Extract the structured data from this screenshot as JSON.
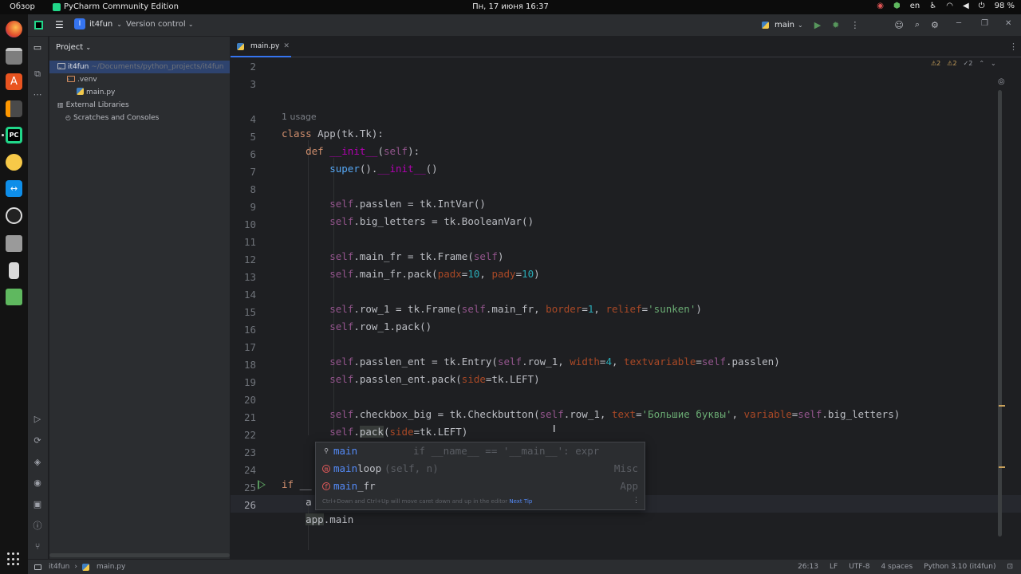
{
  "topbar": {
    "activities": "Обзор",
    "app_name": "PyCharm Community Edition",
    "clock": "Пн, 17 июня  16:37",
    "keyboard_layout": "en",
    "battery": "98 %"
  },
  "ide_header": {
    "project_badge": "I",
    "project_name": "it4fun",
    "vcs_label": "Version control",
    "run_config": "main"
  },
  "project_panel": {
    "title": "Project",
    "tree": [
      {
        "label": "it4fun",
        "hint": "~/Documents/python_projects/it4fun"
      },
      {
        "label": ".venv"
      },
      {
        "label": "main.py"
      },
      {
        "label": "External Libraries"
      },
      {
        "label": "Scratches and Consoles"
      }
    ]
  },
  "editor": {
    "tab_label": "main.py",
    "inspection_counts": {
      "warnings": "2",
      "weak_warnings": "2",
      "typos": "2"
    },
    "usage_hint": "1 usage",
    "line_numbers": [
      "2",
      "3",
      "4",
      "5",
      "6",
      "7",
      "8",
      "9",
      "10",
      "11",
      "12",
      "13",
      "14",
      "15",
      "16",
      "17",
      "18",
      "19",
      "20",
      "21",
      "22",
      "23",
      "24",
      "25",
      "26"
    ]
  },
  "completion": {
    "items": [
      {
        "match": "main",
        "rest": "",
        "extra": "if __name__ == '__main__': expr",
        "type": ""
      },
      {
        "match": "main",
        "rest": "loop",
        "extra": "(self, n)",
        "type": "Misc"
      },
      {
        "match": "main",
        "rest": "_fr",
        "extra": "",
        "type": "App"
      }
    ],
    "hint_text": "Ctrl+Down and Ctrl+Up will move caret down and up in the editor",
    "hint_link": "Next Tip"
  },
  "statusbar": {
    "crumb_project": "it4fun",
    "crumb_file": "main.py",
    "position": "26:13",
    "line_sep": "LF",
    "encoding": "UTF-8",
    "indent": "4 spaces",
    "interpreter": "Python 3.10 (it4fun)"
  }
}
